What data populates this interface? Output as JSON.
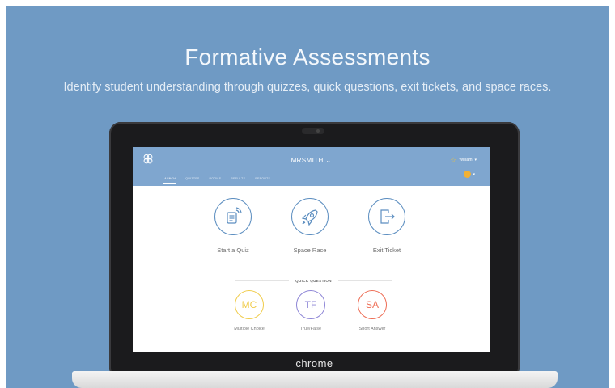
{
  "hero": {
    "title": "Formative Assessments",
    "subtitle": "Identify student understanding through quizzes, quick questions, exit tickets, and space races."
  },
  "app": {
    "class_name": "MRSMITH",
    "user_name": "William",
    "nav_tabs": [
      "LAUNCH",
      "QUIZZES",
      "ROOMS",
      "RESULTS",
      "REPORTS"
    ],
    "launch_items": [
      {
        "label": "Start a Quiz",
        "icon": "quiz-icon"
      },
      {
        "label": "Space Race",
        "icon": "rocket-icon"
      },
      {
        "label": "Exit Ticket",
        "icon": "exit-icon"
      }
    ],
    "quick_question_label": "QUICK QUESTION",
    "quick_questions": [
      {
        "abbr": "MC",
        "label": "Multiple Choice",
        "color": "#f0cc4c"
      },
      {
        "abbr": "TF",
        "label": "True/False",
        "color": "#8e86d6"
      },
      {
        "abbr": "SA",
        "label": "Short Answer",
        "color": "#ee6e56"
      }
    ],
    "accent_color": "#5c8ec0",
    "header_color": "#7fa6cf"
  },
  "device": {
    "brand": "chrome"
  }
}
